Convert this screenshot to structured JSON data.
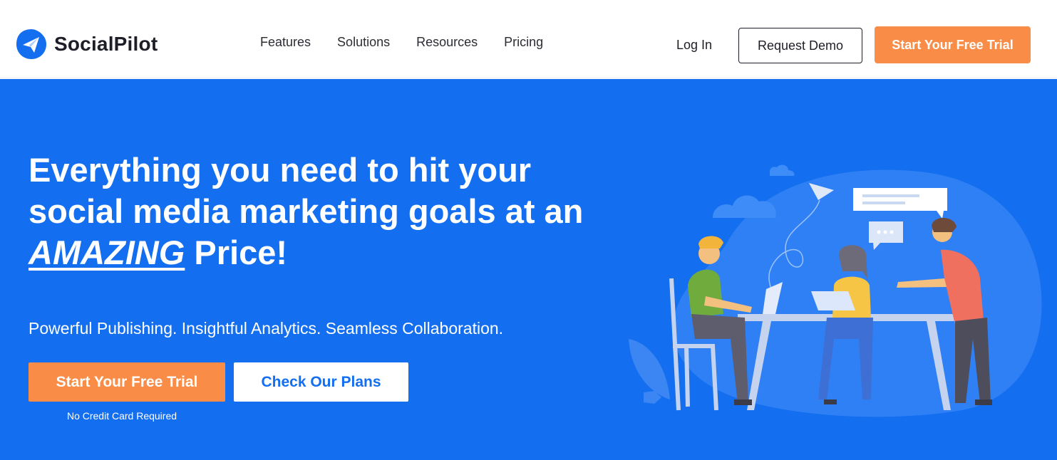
{
  "header": {
    "brand_name": "SocialPilot",
    "nav_items": [
      "Features",
      "Solutions",
      "Resources",
      "Pricing"
    ],
    "login_label": "Log In",
    "request_demo_label": "Request Demo",
    "free_trial_label": "Start Your Free Trial"
  },
  "hero": {
    "headline_line1": "Everything you need to hit your",
    "headline_line2": "social media marketing goals at an",
    "headline_emphasis": "AMAZING",
    "headline_tail": " Price!",
    "subheadline": "Powerful Publishing. Insightful Analytics. Seamless Collaboration.",
    "cta_trial_label": "Start Your Free Trial",
    "cta_plans_label": "Check Our Plans",
    "note": "No Credit Card Required"
  },
  "colors": {
    "brand_blue": "#146ef0",
    "accent_orange": "#f98d47"
  }
}
